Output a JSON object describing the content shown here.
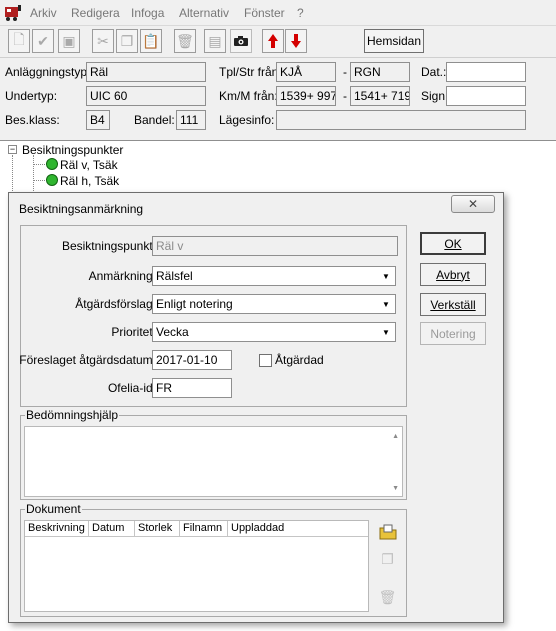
{
  "menu": {
    "items": [
      "Arkiv",
      "Redigera",
      "Infoga",
      "Alternativ",
      "Fönster",
      "?"
    ]
  },
  "toolbar": {
    "home_label": "Hemsidan"
  },
  "header": {
    "anlaggningstyp_label": "Anläggningstyp:",
    "anlaggningstyp_value": "Räl",
    "undertyp_label": "Undertyp:",
    "undertyp_value": "UIC 60",
    "besklass_label": "Bes.klass:",
    "besklass_value": "B4",
    "bandel_label": "Bandel:",
    "bandel_value": "111",
    "tpl_label": "Tpl/Str från:",
    "tpl_from": "KJÅ",
    "tpl_dash": "-",
    "tpl_to": "RGN",
    "km_label": "Km/M från:",
    "km_from": "1539+ 997",
    "km_dash": "-",
    "km_to": "1541+ 719",
    "lagesinfo_label": "Lägesinfo:",
    "dat_label": "Dat.:",
    "sign_label": "Sign:"
  },
  "tree": {
    "root": "Besiktningspunkter",
    "children": [
      "Räl v, Tsäk",
      "Räl h, Tsäk"
    ]
  },
  "dialog": {
    "title": "Besiktningsanmärkning",
    "close_label": "✕",
    "fields": {
      "besiktningspunkt_label": "Besiktningspunkt:",
      "besiktningspunkt_value": "Räl v",
      "anmarkning_label": "Anmärkning:",
      "anmarkning_value": "Rälsfel",
      "atgardsforslag_label": "Åtgärdsförslag:",
      "atgardsforslag_value": "Enligt notering",
      "prioritet_label": "Prioritet:",
      "prioritet_value": "Vecka",
      "datum_label": "Föreslaget åtgärdsdatum:",
      "datum_value": "2017-01-10",
      "atgardad_label": "Åtgärdad",
      "ofelia_label": "Ofelia-id:",
      "ofelia_value": "FR"
    },
    "buttons": {
      "ok": "OK",
      "avbryt": "Avbryt",
      "verkstall": "Verkställ",
      "notering": "Notering"
    },
    "bedomning_title": "Bedömningshjälp",
    "dokument_title": "Dokument",
    "doc_columns": [
      "Beskrivning",
      "Datum",
      "Storlek",
      "Filnamn",
      "Uppladdad"
    ]
  }
}
